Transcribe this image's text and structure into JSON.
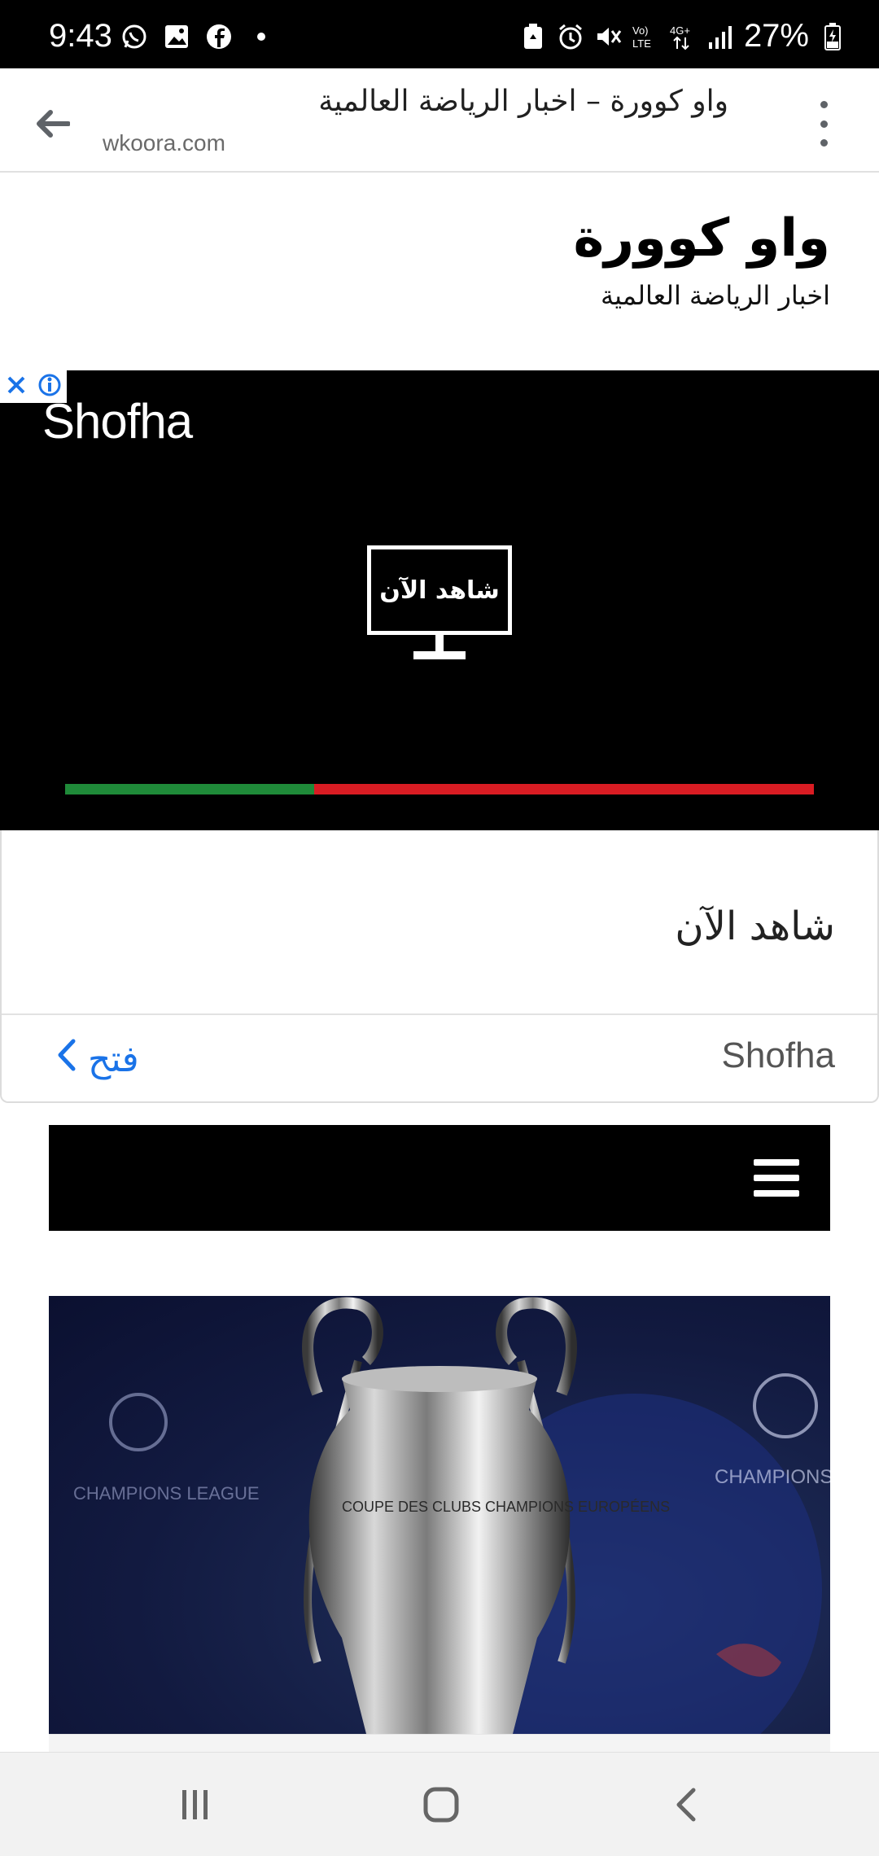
{
  "status_bar": {
    "time": "9:43",
    "battery": "27%",
    "icons": [
      "whatsapp-icon",
      "gallery-icon",
      "facebook-icon",
      "dot-icon",
      "battery-saver-icon",
      "alarm-icon",
      "mute-icon",
      "volte-icon",
      "4g-icon",
      "signal-icon",
      "battery-icon"
    ]
  },
  "browser": {
    "title": "واو كوورة – اخبار الرياضة العالمية",
    "url": "wkoora.com"
  },
  "site": {
    "title": "واو كوورة",
    "tagline": "اخبار الرياضة العالمية"
  },
  "ad": {
    "logo": "Shofha",
    "screen_text": "شاهد الآن",
    "progress": 0.333,
    "headline": "شاهد الآن",
    "advertiser": "Shofha",
    "open_label": "فتح",
    "colors": {
      "progress_done": "#1f8a39",
      "progress_rest": "#d91c23",
      "open": "#1a73e8"
    }
  },
  "nav": {
    "menu_icon": "hamburger-icon"
  },
  "article": {
    "image_text_left": "CHAMPIONS LEAGUE",
    "image_text_right": "CHAMPIONS LEAGUE",
    "trophy_text": "COUPE DES CLUBS CHAMPIONS EUROPÉENS"
  }
}
